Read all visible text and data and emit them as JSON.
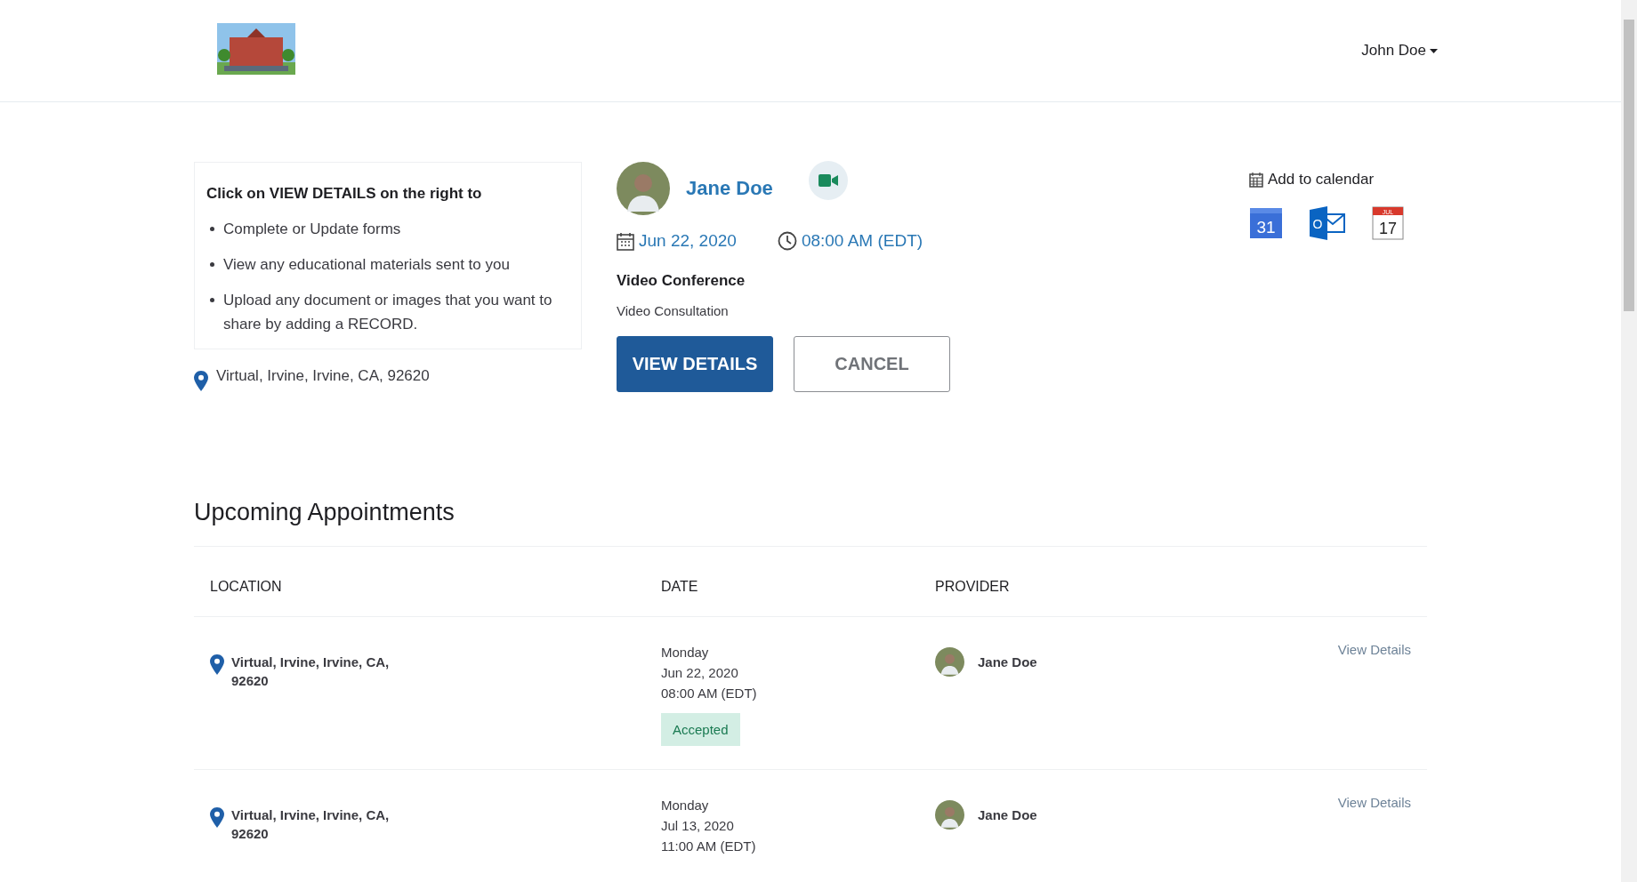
{
  "header": {
    "user_menu": "John Doe"
  },
  "next_appointment": {
    "instructions_title": "Click on VIEW DETAILS on the right to",
    "instructions": [
      "Complete or Update forms",
      "View any educational materials sent to you",
      "Upload any document or images that you want to share by adding a RECORD."
    ],
    "location": "Virtual, Irvine, Irvine, CA, 92620",
    "provider": "Jane Doe",
    "date": "Jun 22, 2020",
    "time": "08:00 AM (EDT)",
    "type": "Video Conference",
    "description": "Video Consultation",
    "buttons": [
      {
        "label": "VIEW DETAILS",
        "kind": "primary"
      },
      {
        "label": "CANCEL",
        "kind": "outline"
      }
    ],
    "add_to_calendar": "Add to calendar",
    "calendar_options": [
      {
        "kind": "google",
        "day": "31"
      },
      {
        "kind": "outlook",
        "letter": "O"
      },
      {
        "kind": "apple",
        "month": "JUL",
        "day": "17"
      }
    ]
  },
  "upcoming": {
    "title": "Upcoming Appointments",
    "columns": [
      "LOCATION",
      "DATE",
      "PROVIDER"
    ],
    "rows": [
      {
        "location": "Virtual, Irvine, Irvine, CA, 92620",
        "weekday": "Monday",
        "date": "Jun 22, 2020",
        "time": "08:00 AM (EDT)",
        "status": "Accepted",
        "provider": "Jane Doe",
        "action": "View Details"
      },
      {
        "location": "Virtual, Irvine, Irvine, CA, 92620",
        "weekday": "Monday",
        "date": "Jul 13, 2020",
        "time": "11:00 AM (EDT)",
        "provider": "Jane Doe",
        "action": "View Details"
      }
    ]
  }
}
